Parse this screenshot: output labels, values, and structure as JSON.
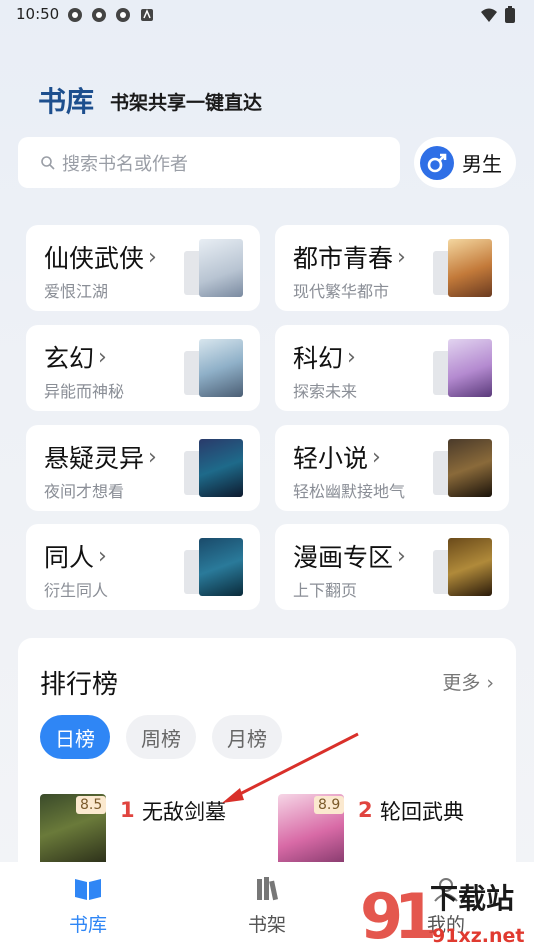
{
  "status_bar": {
    "time": "10:50"
  },
  "header": {
    "title": "书库",
    "subtitle": "书架共享一键直达"
  },
  "search": {
    "placeholder": "搜索书名或作者"
  },
  "gender_toggle": {
    "label": "男生"
  },
  "categories": [
    {
      "title": "仙侠武侠",
      "subtitle": "爱恨江湖"
    },
    {
      "title": "都市青春",
      "subtitle": "现代繁华都市"
    },
    {
      "title": "玄幻",
      "subtitle": "异能而神秘"
    },
    {
      "title": "科幻",
      "subtitle": "探索未来"
    },
    {
      "title": "悬疑灵异",
      "subtitle": "夜间才想看"
    },
    {
      "title": "轻小说",
      "subtitle": "轻松幽默接地气"
    },
    {
      "title": "同人",
      "subtitle": "衍生同人"
    },
    {
      "title": "漫画专区",
      "subtitle": "上下翻页"
    }
  ],
  "ranking": {
    "title": "排行榜",
    "more": "更多",
    "tabs": [
      "日榜",
      "周榜",
      "月榜"
    ],
    "books": [
      {
        "rank": "1",
        "name": "无敌剑墓",
        "score": "8.5"
      },
      {
        "rank": "2",
        "name": "轮回武典",
        "score": "8.9"
      }
    ]
  },
  "bottom_nav": [
    {
      "label": "书库"
    },
    {
      "label": "书架"
    },
    {
      "label": "我的"
    }
  ],
  "watermark": {
    "text": "下载站",
    "domain": "91xz.net"
  },
  "colors": {
    "accent": "#2f86f5",
    "brand_title": "#1d4f8e",
    "rank_number": "#e0443f"
  }
}
